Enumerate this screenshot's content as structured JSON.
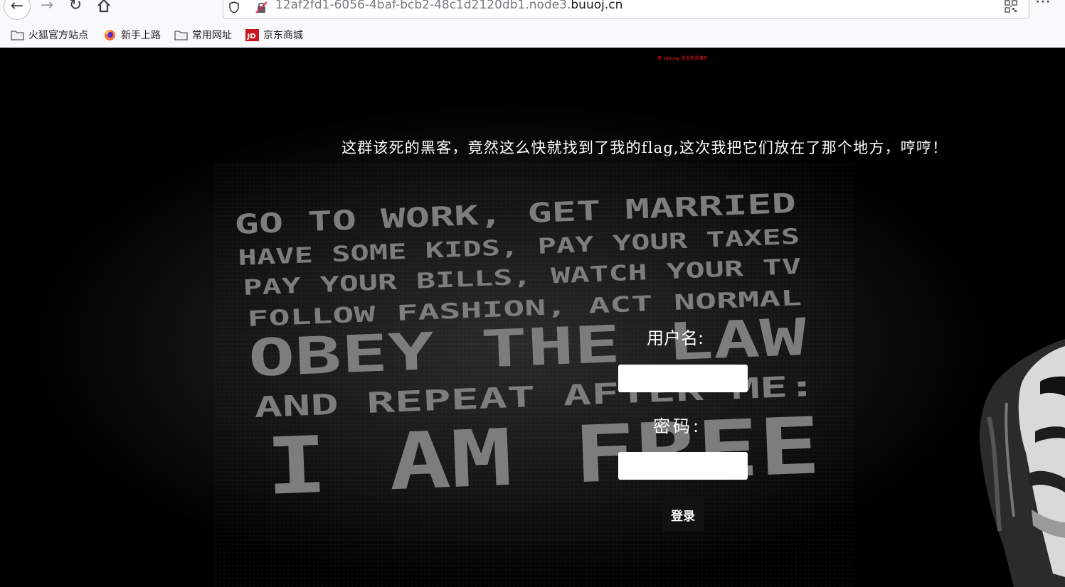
{
  "browser": {
    "url_path": "12af2fd1-6056-4baf-bcb2-48c1d2120db1.node3.",
    "url_domain": "buuoj.cn",
    "menu_icon": "⋯",
    "bookmarks": [
      {
        "label": "火狐官方站点",
        "icon": "folder-icon"
      },
      {
        "label": "新手上路",
        "icon": "firefox-icon"
      },
      {
        "label": "常用网址",
        "icon": "folder-icon"
      },
      {
        "label": "京东商城",
        "icon": "jd-icon"
      }
    ]
  },
  "page": {
    "top_notice": "用 sqlmap 是没有灵魂的",
    "hacker_message": "这群该死的黑客，竟然这么快就找到了我的flag,这次我把它们放在了那个地方，哼哼！",
    "poster_lines": [
      "GO TO WORK, GET MARRIED",
      "HAVE SOME KIDS, PAY YOUR TAXES",
      "PAY YOUR BILLS, WATCH YOUR TV",
      "FOLLOW FASHION, ACT NORMAL",
      "OBEY THE LAW",
      "AND REPEAT AFTER ME:",
      "I AM FREE"
    ],
    "form": {
      "username_label": "用户名:",
      "username_value": "",
      "password_label": "密码:",
      "password_value": "",
      "login_button": "登录"
    }
  }
}
